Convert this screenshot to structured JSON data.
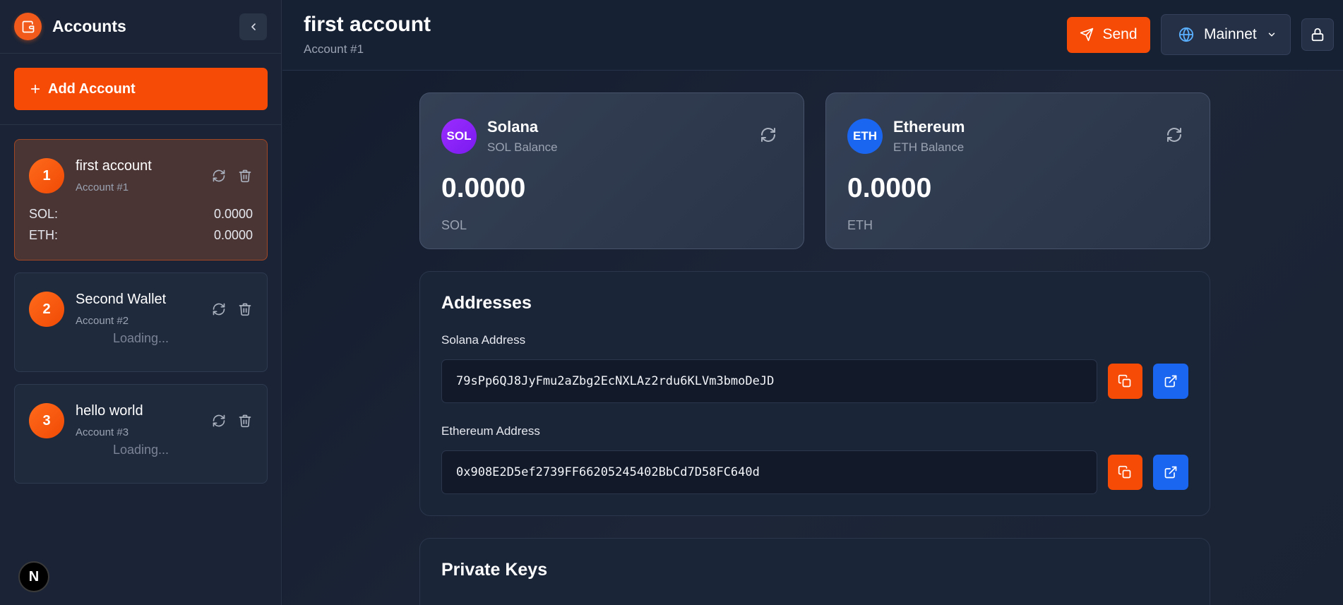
{
  "sidebar": {
    "title": "Accounts",
    "add_account_label": "Add Account",
    "accounts": [
      {
        "number": "1",
        "name": "first account",
        "sub": "Account #1",
        "balances": [
          {
            "label": "SOL:",
            "value": "0.0000"
          },
          {
            "label": "ETH:",
            "value": "0.0000"
          }
        ]
      },
      {
        "number": "2",
        "name": "Second Wallet",
        "sub": "Account #2",
        "status": "Loading..."
      },
      {
        "number": "3",
        "name": "hello world",
        "sub": "Account #3",
        "status": "Loading..."
      }
    ],
    "badge": "N"
  },
  "header": {
    "title": "first account",
    "subtitle": "Account #1",
    "send_label": "Send",
    "network_label": "Mainnet"
  },
  "balances": [
    {
      "symbol": "SOL",
      "name": "Solana",
      "sub": "SOL Balance",
      "amount": "0.0000",
      "unit": "SOL",
      "color": "#9b2cff"
    },
    {
      "symbol": "ETH",
      "name": "Ethereum",
      "sub": "ETH Balance",
      "amount": "0.0000",
      "unit": "ETH",
      "color": "#1b66f0"
    }
  ],
  "addresses": {
    "title": "Addresses",
    "solana_label": "Solana Address",
    "solana_value": "79sPp6QJ8JyFmu2aZbg2EcNXLAz2rdu6KLVm3bmoDeJD",
    "ethereum_label": "Ethereum Address",
    "ethereum_value": "0x908E2D5ef2739FF66205245402BbCd7D58FC640d"
  },
  "private_keys": {
    "title": "Private Keys"
  },
  "colors": {
    "accent": "#f64b06",
    "blue": "#1b66f0",
    "purple": "#9b2cff"
  }
}
